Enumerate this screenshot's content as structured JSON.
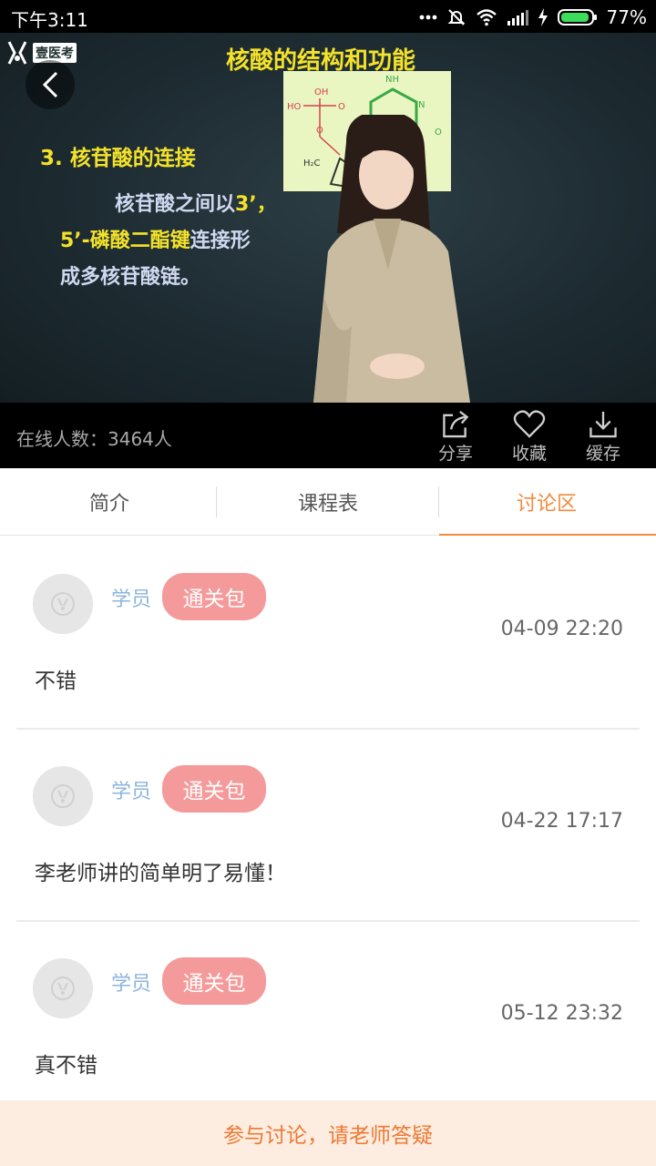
{
  "status_bar": {
    "time": "下午3:11",
    "battery": "77%"
  },
  "video": {
    "logo": "壹医考",
    "slide_title": "核酸的结构和功能",
    "section_heading": "3. 核苷酸的连接",
    "line1_a": "核苷酸之间以",
    "line1_b": "3’，",
    "line2_a": "5’-磷酸二酯键",
    "line2_b": "连接形",
    "line3": "成多核苷酸链。"
  },
  "video_bar": {
    "online_count": "在线人数：3464人",
    "share_label": "分享",
    "favorite_label": "收藏",
    "cache_label": "缓存"
  },
  "tabs": [
    {
      "label": "简介"
    },
    {
      "label": "课程表"
    },
    {
      "label": "讨论区"
    }
  ],
  "comments": [
    {
      "role": "学员",
      "badge": "通关包",
      "time": "04-09 22:20",
      "text": "不错"
    },
    {
      "role": "学员",
      "badge": "通关包",
      "time": "04-22 17:17",
      "text": "李老师讲的简单明了易懂！"
    },
    {
      "role": "学员",
      "badge": "通关包",
      "time": "05-12 23:32",
      "text": "真不错"
    }
  ],
  "bottom_bar": {
    "label": "参与讨论，请老师答疑"
  },
  "colors": {
    "accent": "#f28a3c",
    "badge": "#f59a9a",
    "role": "#8db5db",
    "bottom_bg": "#fdece0"
  }
}
